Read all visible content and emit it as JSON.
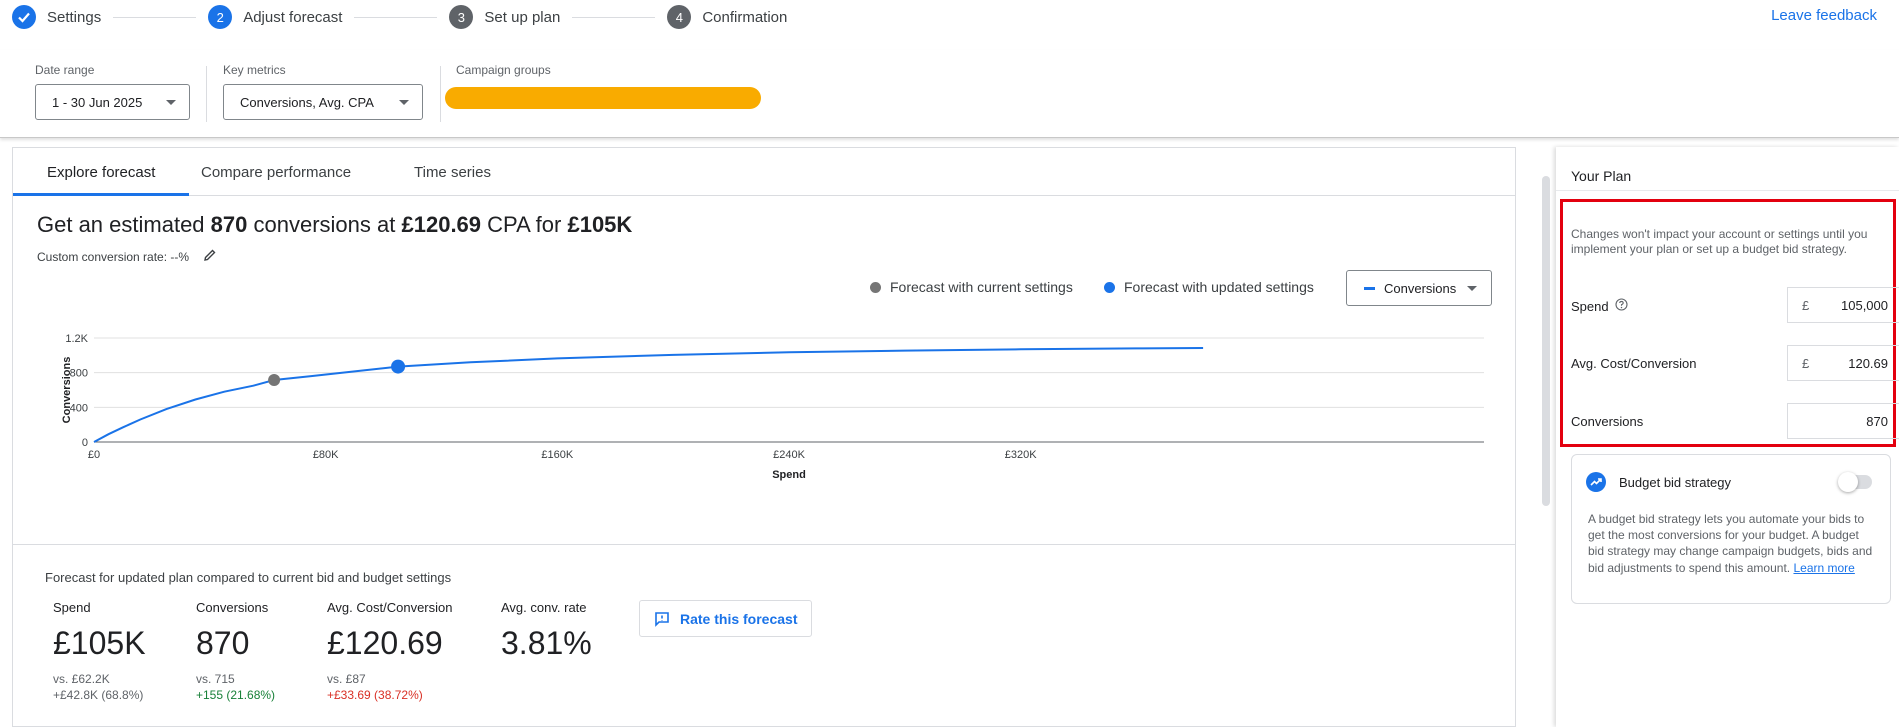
{
  "stepper": {
    "steps": [
      {
        "num": "✓",
        "label": "Settings",
        "state": "done"
      },
      {
        "num": "2",
        "label": "Adjust forecast",
        "state": "active"
      },
      {
        "num": "3",
        "label": "Set up plan",
        "state": "todo"
      },
      {
        "num": "4",
        "label": "Confirmation",
        "state": "todo"
      }
    ],
    "leave_feedback": "Leave feedback"
  },
  "filters": {
    "date_range": {
      "label": "Date range",
      "value": "1 - 30 Jun 2025"
    },
    "key_metrics": {
      "label": "Key metrics",
      "value": "Conversions, Avg. CPA"
    },
    "campaign_groups": {
      "label": "Campaign groups",
      "value_redacted": true
    }
  },
  "tabs": [
    "Explore forecast",
    "Compare performance",
    "Time series"
  ],
  "headline": {
    "prefix": "Get an estimated",
    "conversions": "870",
    "mid": "conversions at",
    "cpa": "£120.69",
    "mid2": "CPA for",
    "spend": "£105K"
  },
  "custom_conversion_rate": "Custom conversion rate: --%",
  "legend": {
    "current": "Forecast with current settings",
    "updated": "Forecast with updated settings",
    "metric_select": "Conversions"
  },
  "colors": {
    "accent": "#1a73e8",
    "current_dot": "#757575",
    "positive": "#188038",
    "negative": "#d93025",
    "highlight_border": "#e3000f"
  },
  "chart_data": {
    "type": "line",
    "xlabel": "Spend",
    "ylabel": "Conversions",
    "xlim": [
      0,
      480000
    ],
    "ylim": [
      0,
      1200
    ],
    "x_ticks": [
      0,
      80000,
      160000,
      240000,
      320000
    ],
    "x_tick_labels": [
      "£0",
      "£80K",
      "£160K",
      "£240K",
      "£320K"
    ],
    "y_ticks": [
      0,
      400,
      800,
      1200
    ],
    "y_tick_labels": [
      "0",
      "400",
      "800",
      "1.2K"
    ],
    "grid": true,
    "series": [
      {
        "x": [
          0,
          5000,
          10000,
          16000,
          25000,
          35000,
          45000,
          55000,
          62200,
          75000,
          90000,
          105000,
          130000,
          160000,
          200000,
          240000,
          280000,
          320000,
          360000,
          383000
        ],
        "y": [
          0,
          90,
          170,
          260,
          380,
          490,
          580,
          650,
          715,
          760,
          815,
          870,
          920,
          965,
          1005,
          1035,
          1055,
          1070,
          1080,
          1085
        ]
      }
    ],
    "points": [
      {
        "name": "Forecast with current settings",
        "x": 62200,
        "y": 715
      },
      {
        "name": "Forecast with updated settings",
        "x": 105000,
        "y": 870
      }
    ]
  },
  "comparison": {
    "title": "Forecast for updated plan compared to current bid and budget settings",
    "stats": [
      {
        "label": "Spend",
        "value": "£105K",
        "vs": "vs. £62.2K",
        "delta": "+£42.8K (68.8%)",
        "delta_kind": "neutral"
      },
      {
        "label": "Conversions",
        "value": "870",
        "vs": "vs. 715",
        "delta": "+155 (21.68%)",
        "delta_kind": "positive"
      },
      {
        "label": "Avg. Cost/Conversion",
        "value": "£120.69",
        "vs": "vs. £87",
        "delta": "+£33.69 (38.72%)",
        "delta_kind": "negative"
      },
      {
        "label": "Avg. conv. rate",
        "value": "3.81%",
        "vs": "",
        "delta": "",
        "delta_kind": "neutral"
      }
    ],
    "rate_button": "Rate this forecast"
  },
  "plan": {
    "title": "Your Plan",
    "notice": "Changes won't impact your account or settings until you implement your plan or set up a budget bid strategy.",
    "rows": [
      {
        "label": "Spend",
        "currency": "£",
        "value": "105,000"
      },
      {
        "label": "Avg. Cost/Conversion",
        "currency": "£",
        "value": "120.69"
      },
      {
        "label": "Conversions",
        "currency": "",
        "value": "870"
      }
    ],
    "bbs": {
      "title": "Budget bid strategy",
      "enabled": false,
      "desc": "A budget bid strategy lets you automate your bids to get the most conversions for your budget. A budget bid strategy may change campaign budgets, bids and bid adjustments to spend this amount.",
      "learn_more": "Learn more"
    }
  }
}
